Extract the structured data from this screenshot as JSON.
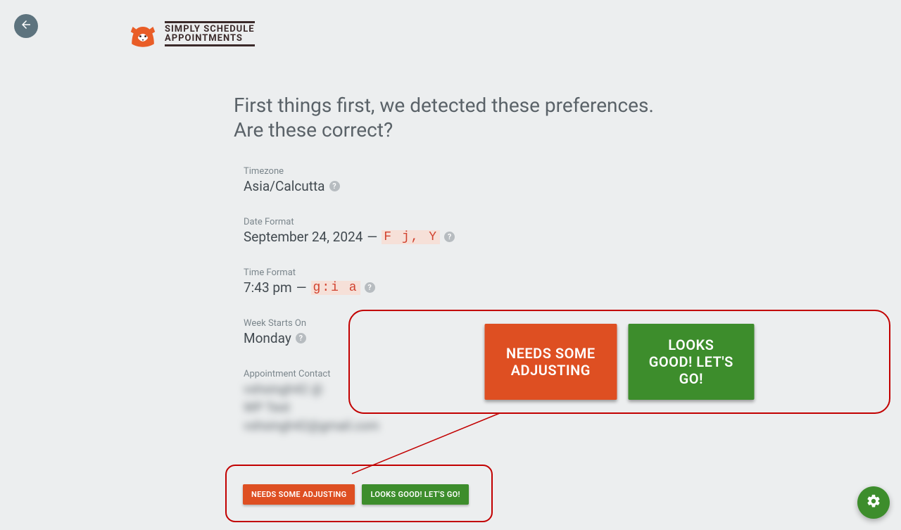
{
  "logo": {
    "line1": "SIMPLY SCHEDULE",
    "line2": "APPOINTMENTS"
  },
  "heading": {
    "line1": "First things first, we detected these preferences.",
    "line2": "Are these correct?"
  },
  "fields": {
    "timezone": {
      "label": "Timezone",
      "value": "Asia/Calcutta"
    },
    "dateformat": {
      "label": "Date Format",
      "value": "September 24, 2024",
      "sep": "—",
      "code": "F j, Y"
    },
    "timeformat": {
      "label": "Time Format",
      "value": "7:43 pm",
      "sep": "—",
      "code": "g:i a"
    },
    "weekstart": {
      "label": "Week Starts On",
      "value": "Monday"
    },
    "contact": {
      "label": "Appointment Contact",
      "line1": "vshsingh42 @",
      "line2": "WP Test",
      "line3": "vshsingh42@gmail.com"
    }
  },
  "buttons": {
    "adjust": "NEEDS SOME ADJUSTING",
    "go": "LOOKS GOOD! LET'S GO!"
  }
}
